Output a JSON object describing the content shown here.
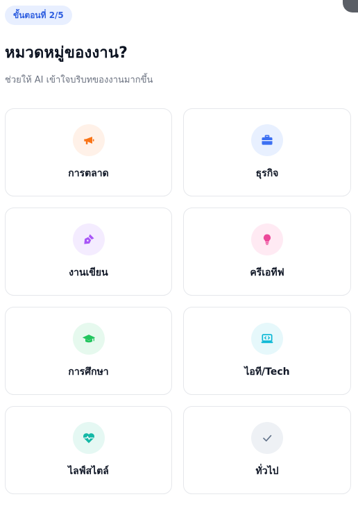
{
  "step_badge": "ขั้นตอนที่ 2/5",
  "title": "หมวดหมู่ของงาน?",
  "subtitle": "ช่วยให้ AI เข้าใจบริบทของงานมากขึ้น",
  "categories": [
    {
      "label": "การตลาด",
      "icon": "megaphone-icon",
      "bg": "#fff1e8",
      "fg": "#f97316"
    },
    {
      "label": "ธุรกิจ",
      "icon": "briefcase-icon",
      "bg": "#e8f0ff",
      "fg": "#3b6ff2"
    },
    {
      "label": "งานเขียน",
      "icon": "pen-nib-icon",
      "bg": "#f4ecff",
      "fg": "#a855f7"
    },
    {
      "label": "ครีเอทีฟ",
      "icon": "lightbulb-icon",
      "bg": "#ffeaf3",
      "fg": "#ec4899"
    },
    {
      "label": "การศึกษา",
      "icon": "graduation-cap-icon",
      "bg": "#e6f9ee",
      "fg": "#22c55e"
    },
    {
      "label": "ไอที/Tech",
      "icon": "laptop-code-icon",
      "bg": "#e6f8fb",
      "fg": "#06b6d4"
    },
    {
      "label": "ไลฟ์สไตล์",
      "icon": "heart-pulse-icon",
      "bg": "#e5f8f3",
      "fg": "#14b8a6"
    },
    {
      "label": "ทั่วไป",
      "icon": "check-icon",
      "bg": "#eef1f5",
      "fg": "#64748b"
    }
  ]
}
